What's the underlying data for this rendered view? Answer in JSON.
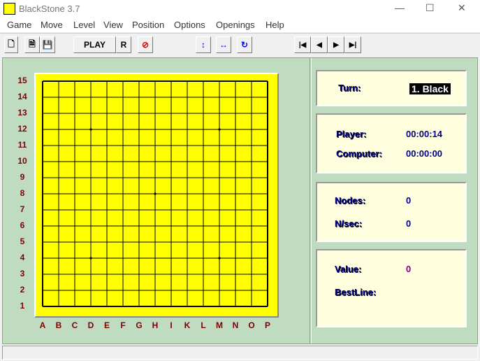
{
  "window": {
    "title": "BlackStone 3.7",
    "minimize": "—",
    "maximize": "☐",
    "close": "✕"
  },
  "menu": [
    "Game",
    "Move",
    "Level",
    "View",
    "Position",
    "Options",
    "Openings",
    "Help"
  ],
  "toolbar": {
    "play": "PLAY",
    "r": "R",
    "nav": [
      "|◀",
      "◀",
      "▶",
      "▶|"
    ]
  },
  "board": {
    "rows": [
      "15",
      "14",
      "13",
      "12",
      "11",
      "10",
      "9",
      "8",
      "7",
      "6",
      "5",
      "4",
      "3",
      "2",
      "1"
    ],
    "cols": [
      "A",
      "B",
      "C",
      "D",
      "E",
      "F",
      "G",
      "H",
      "I",
      "K",
      "L",
      "M",
      "N",
      "O",
      "P"
    ]
  },
  "info": {
    "turn_label": "Turn:",
    "turn_value": "1. Black",
    "player_label": "Player:",
    "player_time": "00:00:14",
    "computer_label": "Computer:",
    "computer_time": "00:00:00",
    "nodes_label": "Nodes:",
    "nodes_value": "0",
    "nps_label": "N/sec:",
    "nps_value": "0",
    "value_label": "Value:",
    "value_value": "0",
    "bestline_label": "BestLine:"
  }
}
